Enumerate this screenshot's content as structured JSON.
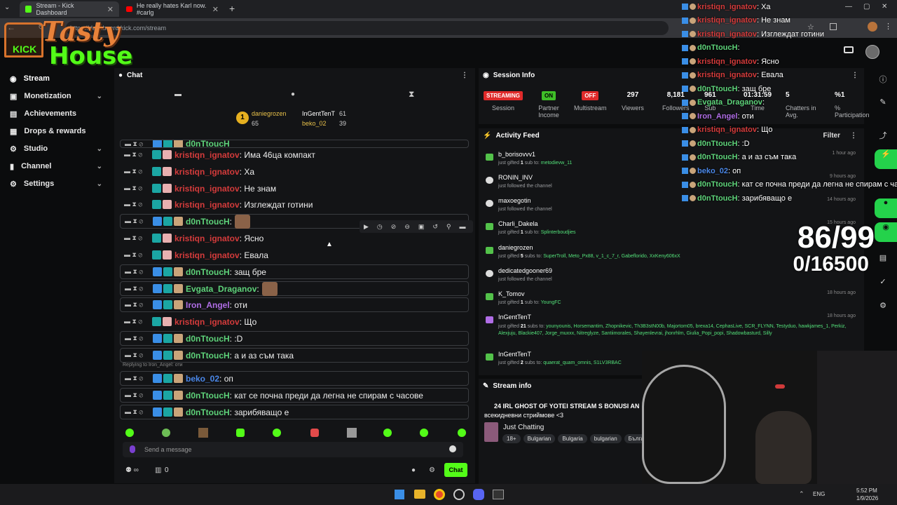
{
  "browser": {
    "tabs": [
      {
        "title": "Stream - Kick Dashboard"
      },
      {
        "title": "He really hates Karl now. #carlg"
      }
    ],
    "url": "https://dashboard.kick.com/stream",
    "new_tab": "+"
  },
  "logo": {
    "line1": "Tasty",
    "line2": "House",
    "brand": "KICK"
  },
  "sidebar": {
    "items": [
      {
        "label": "Stream",
        "icon": "broadcast-icon",
        "active": true
      },
      {
        "label": "Monetization",
        "icon": "wallet-icon",
        "chevron": true
      },
      {
        "label": "Achievements",
        "icon": "trophy-icon"
      },
      {
        "label": "Drops & rewards",
        "icon": "gift-icon"
      },
      {
        "label": "Studio",
        "icon": "gear-icon",
        "chevron": true
      },
      {
        "label": "Channel",
        "icon": "person-icon",
        "chevron": true
      },
      {
        "label": "Settings",
        "icon": "settings-icon",
        "chevron": true
      }
    ]
  },
  "chat": {
    "title": "Chat",
    "pinned": {
      "user1": "daniegrozen",
      "user1_count": "65",
      "user2": "InGentTenT",
      "user2_count": "61",
      "user3": "beko_02",
      "user3_count": "39",
      "rank": "1"
    },
    "messages": [
      {
        "user": "d0nTtoucH",
        "text": "",
        "color": "green"
      },
      {
        "user": "kristiqn_ignatov",
        "text": ": Има 46ца компакт",
        "color": "red"
      },
      {
        "user": "kristiqn_ignatov",
        "text": ": Ха",
        "color": "red"
      },
      {
        "user": "kristiqn_ignatov",
        "text": ": Не знам",
        "color": "red"
      },
      {
        "user": "kristiqn_ignatov",
        "text": ": Изглеждат готини",
        "color": "red"
      },
      {
        "user": "d0nTtoucH",
        "text": ":",
        "color": "green",
        "emote": true
      },
      {
        "user": "kristiqn_ignatov",
        "text": ": Ясно",
        "color": "red"
      },
      {
        "user": "kristiqn_ignatov",
        "text": ": Евала",
        "color": "red"
      },
      {
        "user": "d0nTtoucH",
        "text": ": защ бре",
        "color": "green"
      },
      {
        "user": "Evgata_Draganov",
        "text": ":",
        "color": "green",
        "emote": true
      },
      {
        "user": "Iron_Angel",
        "text": ": оти",
        "color": "purple"
      },
      {
        "user": "kristiqn_ignatov",
        "text": ": Що",
        "color": "red"
      },
      {
        "user": "d0nTtoucH",
        "text": ": :D",
        "color": "green"
      },
      {
        "user": "d0nTtoucH",
        "text": ": а и аз съм така",
        "color": "green"
      },
      {
        "user": "beko_02",
        "text": ": оп",
        "color": "blue",
        "reply": "Replying to Iron_Angel: оти"
      },
      {
        "user": "d0nTtoucH",
        "text": ": кат се почна преди да легна не спирам с часове",
        "color": "green"
      },
      {
        "user": "d0nTtoucH",
        "text": ": зарибяващо е",
        "color": "green"
      }
    ],
    "input_placeholder": "Send a message",
    "send_label": "Chat",
    "footer_count": "0"
  },
  "session": {
    "title": "Session Info",
    "streaming": "STREAMING",
    "on": "ON",
    "off": "OFF",
    "labels": {
      "session": "Session",
      "partner": "Partner Income",
      "multistream": "Multistream",
      "viewers": "Viewers",
      "followers": "Followers",
      "sub": "Sub",
      "time": "Time",
      "chatters": "Chatters in Avg.",
      "participation": "% Participation"
    },
    "values": {
      "viewers": "297",
      "followers": "8,181",
      "sub": "961",
      "time": "01:31:59",
      "chatters": "5",
      "participation": "%1"
    }
  },
  "activity": {
    "title": "Activity Feed",
    "filter": "Filter",
    "items": [
      {
        "name": "b_borisovvv1",
        "pre": "just gifted ",
        "bold": "1",
        "mid": " sub to: ",
        "target": "metodievw_11",
        "time": "1 hour ago",
        "icon": "gift"
      },
      {
        "name": "RONIN_INV",
        "pre": "just followed the channel",
        "bold": "",
        "mid": "",
        "target": "",
        "time": "9 hours ago",
        "icon": "heart"
      },
      {
        "name": "maxoegotin",
        "pre": "just followed the channel",
        "bold": "",
        "mid": "",
        "target": "",
        "time": "14 hours ago",
        "icon": "heart"
      },
      {
        "name": "Charli_Dakela",
        "pre": "just gifted ",
        "bold": "1",
        "mid": " sub to: ",
        "target": "Splinterboudjies",
        "time": "15 hours ago",
        "icon": "gift"
      },
      {
        "name": "daniegrozen",
        "pre": "just gifted ",
        "bold": "5",
        "mid": " subs to: ",
        "target": "SuperTroll, Meto_Px88, v_1_c_7_r, Gabeflorido, XxKeny606xX",
        "time": "",
        "icon": "gift"
      },
      {
        "name": "dedicatedgooner69",
        "pre": "just followed the channel",
        "bold": "",
        "mid": "",
        "target": "",
        "time": "",
        "icon": "heart"
      },
      {
        "name": "K_Tomov",
        "pre": "just gifted ",
        "bold": "1",
        "mid": " sub to: ",
        "target": "YoungFC",
        "time": "18 hours ago",
        "icon": "gift"
      },
      {
        "name": "InGentTenT",
        "pre": "just gifted ",
        "bold": "21",
        "mid": " subs to: ",
        "target": "younyounis, Horsemantim, Zhopnikevic, Th3B3stN00b, Majortom05, brexa14, CephasLive, SCR_FLYNN, Testyduo, hawkjames_1, Perkiz, Alexjuju, Blackie407, Jorge_muxxx, Nitreglyze, Santiimorales, Shayenlevrai, jhonrhlm, Giulia_Popi_popi, Shadowbasturd, Silly",
        "time": "18 hours ago",
        "icon": "gift"
      },
      {
        "name": "InGentTenT",
        "pre": "just gifted ",
        "bold": "2",
        "mid": " subs to: ",
        "target": "quaerat_quam_omnis, S1LV3RBAC",
        "time": "",
        "icon": "gift"
      }
    ]
  },
  "stream_info": {
    "title": "Stream info",
    "stream_title": "24 IRL GHOST OF YOTEI STREAM S BONUSI AN",
    "stream_title_2": "всекидневни стриймове <3",
    "category": "Just Chatting",
    "tags": [
      "18+",
      "Bulgarian",
      "Bulgaria",
      "bulgarian",
      "Българ"
    ]
  },
  "overlay_chat": [
    {
      "user": "kristiqn_ignatov",
      "text": ": Ха",
      "color": "red"
    },
    {
      "user": "kristiqn_ignatov",
      "text": ": Не знам",
      "color": "red"
    },
    {
      "user": "kristiqn_ignatov",
      "text": ": Изглеждат готини",
      "color": "red"
    },
    {
      "user": "d0nTtoucH",
      "text": ":",
      "color": "green"
    },
    {
      "user": "kristiqn_ignatov",
      "text": ": Ясно",
      "color": "red"
    },
    {
      "user": "kristiqn_ignatov",
      "text": ": Евала",
      "color": "red"
    },
    {
      "user": "d0nTtoucH",
      "text": ": защ бре",
      "color": "green"
    },
    {
      "user": "Evgata_Draganov",
      "text": ":",
      "color": "green"
    },
    {
      "user": "Iron_Angel",
      "text": ": оти",
      "color": "purple"
    },
    {
      "user": "kristiqn_ignatov",
      "text": ": Що",
      "color": "red"
    },
    {
      "user": "d0nTtoucH",
      "text": ": :D",
      "color": "green"
    },
    {
      "user": "d0nTtoucH",
      "text": ": а и аз съм така",
      "color": "green"
    },
    {
      "user": "beko_02",
      "text": ": оп",
      "color": "blue"
    },
    {
      "user": "d0nTtoucH",
      "text": ": кат се почна преди да легна не спирам с часове",
      "color": "green"
    },
    {
      "user": "d0nTtoucH",
      "text": ": зарибяващо е",
      "color": "green"
    }
  ],
  "counter": {
    "line1": "86/99",
    "line2": "0/16500"
  },
  "taskbar": {
    "lang": "ENG",
    "time": "5:52 PM",
    "date": "1/9/2026"
  },
  "colors": {
    "accent": "#53fc18",
    "red": "#d43b3b",
    "green": "#5ed37a",
    "blue": "#4a87e8",
    "purple": "#b06de6"
  }
}
